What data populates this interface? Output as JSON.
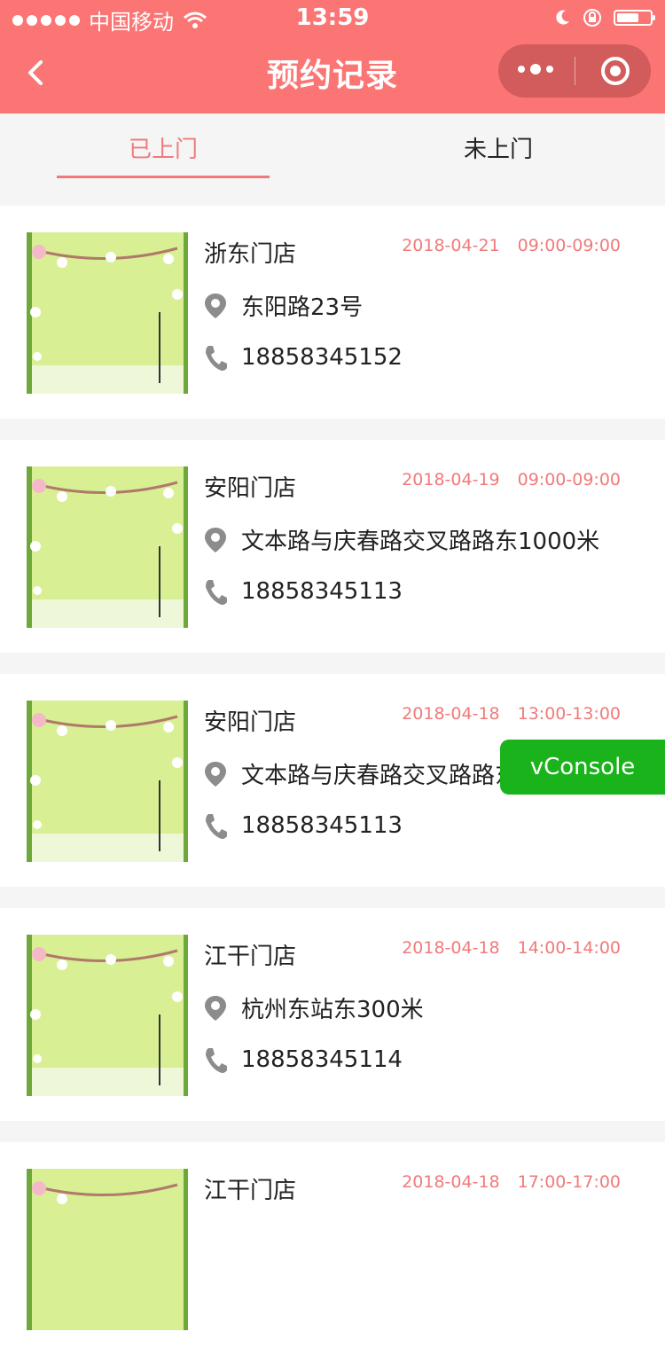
{
  "status_bar": {
    "carrier": "中国移动",
    "time": "13:59"
  },
  "nav": {
    "title": "预约记录"
  },
  "tabs": [
    {
      "label": "已上门",
      "active": true
    },
    {
      "label": "未上门",
      "active": false
    }
  ],
  "records": [
    {
      "store": "浙东门店",
      "date": "2018-04-21",
      "time": "09:00-09:00",
      "address": "东阳路23号",
      "phone": "18858345152"
    },
    {
      "store": "安阳门店",
      "date": "2018-04-19",
      "time": "09:00-09:00",
      "address": "文本路与庆春路交叉路路东1000米",
      "phone": "18858345113"
    },
    {
      "store": "安阳门店",
      "date": "2018-04-18",
      "time": "13:00-13:00",
      "address": "文本路与庆春路交叉路路东1000米",
      "phone": "18858345113"
    },
    {
      "store": "江干门店",
      "date": "2018-04-18",
      "time": "14:00-14:00",
      "address": "杭州东站东300米",
      "phone": "18858345114"
    },
    {
      "store": "江干门店",
      "date": "2018-04-18",
      "time": "17:00-17:00",
      "address": "",
      "phone": ""
    }
  ],
  "vconsole": {
    "label": "vConsole"
  },
  "colors": {
    "nav_bg": "#fb7575",
    "accent": "#f07a7a",
    "vconsole": "#1bb31b"
  }
}
